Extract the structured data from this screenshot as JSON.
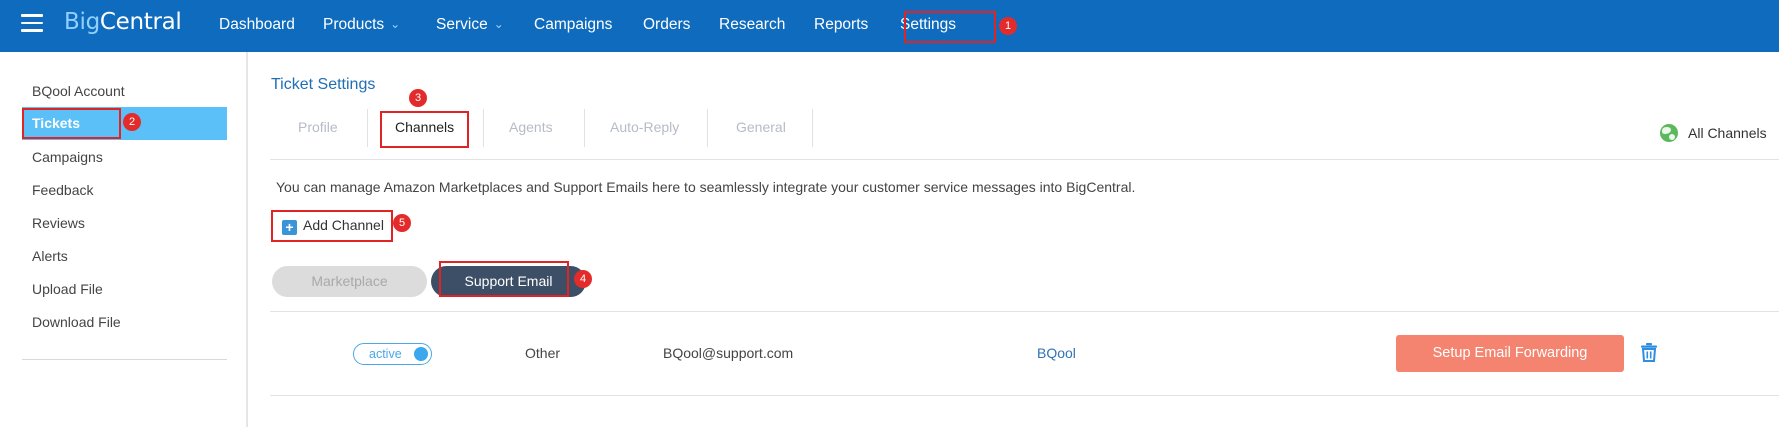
{
  "header": {
    "logo_part1": "Big",
    "logo_part2": "Central",
    "nav": [
      {
        "label": "Dashboard"
      },
      {
        "label": "Products"
      },
      {
        "label": "Service"
      },
      {
        "label": "Campaigns"
      },
      {
        "label": "Orders"
      },
      {
        "label": "Research"
      },
      {
        "label": "Reports"
      },
      {
        "label": "Settings"
      }
    ]
  },
  "sidebar": {
    "items": [
      {
        "label": "BQool Account"
      },
      {
        "label": "Tickets"
      },
      {
        "label": "Campaigns"
      },
      {
        "label": "Feedback"
      },
      {
        "label": "Reviews"
      },
      {
        "label": "Alerts"
      },
      {
        "label": "Upload File"
      },
      {
        "label": "Download File"
      }
    ]
  },
  "main": {
    "title": "Ticket Settings",
    "tabs": [
      {
        "label": "Profile"
      },
      {
        "label": "Channels"
      },
      {
        "label": "Agents"
      },
      {
        "label": "Auto-Reply"
      },
      {
        "label": "General"
      }
    ],
    "channel_filter": "All Channels",
    "description": "You can manage Amazon Marketplaces and Support Emails here to seamlessly integrate your customer service messages into BigCentral.",
    "add_channel_label": "Add Channel",
    "segments": {
      "marketplace": "Marketplace",
      "support_email": "Support Email"
    },
    "rows": [
      {
        "status": "active",
        "type": "Other",
        "email": "BQool@support.com",
        "account": "BQool",
        "action_label": "Setup Email Forwarding"
      }
    ]
  },
  "annotations": {
    "badges": [
      "1",
      "2",
      "3",
      "4",
      "5"
    ],
    "color": "#e02424"
  },
  "colors": {
    "topbar": "#0f6bbd",
    "sidebar_active": "#5bc0f8",
    "accent_button": "#f48470",
    "segment_active": "#3d4f66"
  }
}
